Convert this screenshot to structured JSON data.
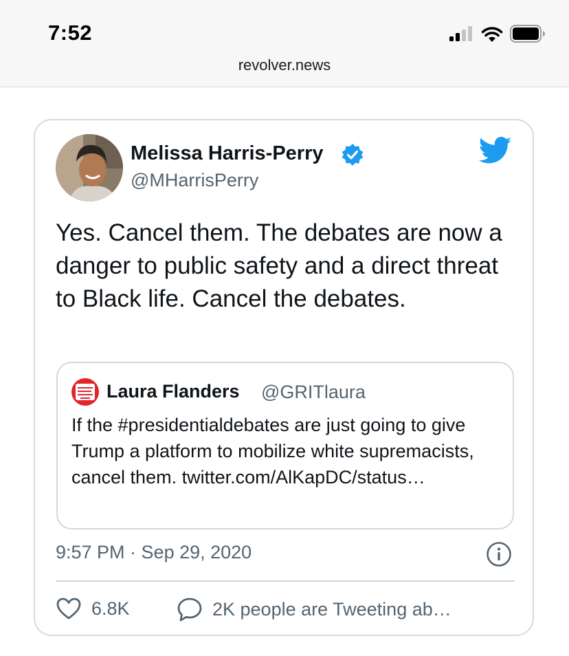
{
  "status_bar": {
    "time": "7:52",
    "url": "revolver.news",
    "icons": [
      "signal-icon",
      "wifi-icon",
      "battery-icon"
    ]
  },
  "tweet": {
    "display_name": "Melissa Harris-Perry",
    "handle": "@MHarrisPerry",
    "verified": true,
    "text": "Yes. Cancel them. The debates are now a danger to public safety and a direct threat to Black life. Cancel the debates.",
    "quoted_tweet": {
      "display_name": "Laura Flanders",
      "handle": "@GRITlaura",
      "text": "If the #presidentialdebates are just going to give Trump a platform to mobilize white supremacists, cancel them. twitter.com/AlKapDC/status…"
    },
    "timestamp": "9:57 PM · Sep 29, 2020",
    "likes": "6.8K",
    "conversation": "2K people are Tweeting ab…"
  },
  "colors": {
    "twitter_blue": "#1d9bf0",
    "secondary_text": "#536471",
    "border": "#cfd9de"
  }
}
